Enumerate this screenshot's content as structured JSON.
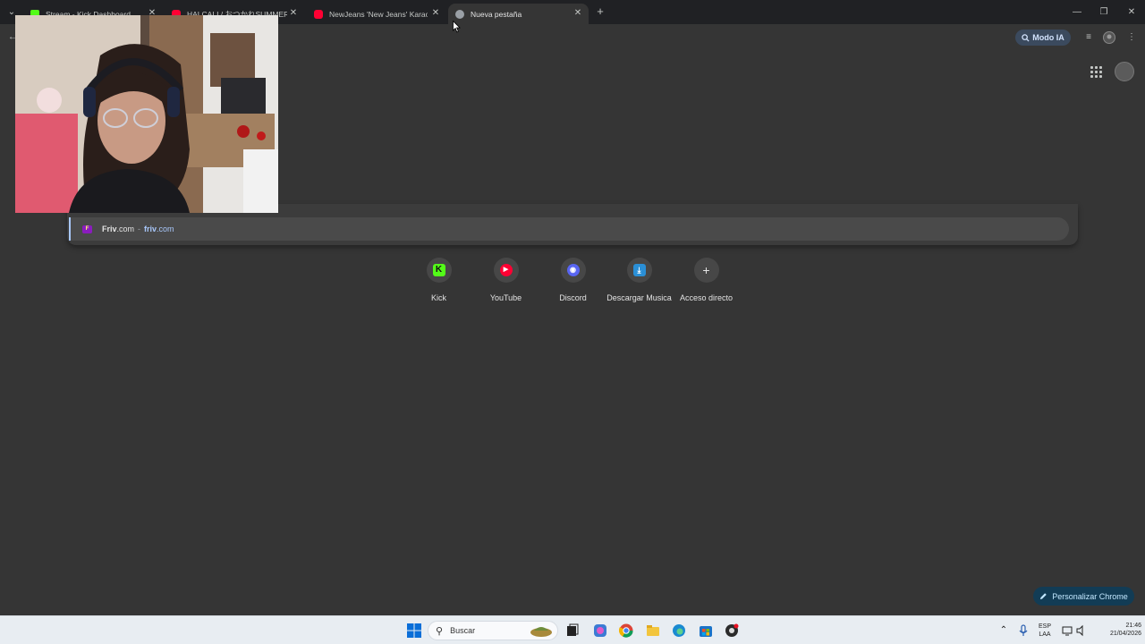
{
  "tabs": [
    {
      "title": "Stream - Kick Dashboard",
      "favicon": "kick-icon"
    },
    {
      "title": "HALCALI / おつかれSUMMER (O",
      "favicon": "youtube-icon"
    },
    {
      "title": "NewJeans 'New Jeans' Karaoke",
      "favicon": "youtube-icon"
    },
    {
      "title": "Nueva pestaña",
      "favicon": "chrome-icon",
      "active": true
    }
  ],
  "toolbar": {
    "ai_mode_label": "Modo IA"
  },
  "suggestion": {
    "name_bold": "Friv",
    "name_rest": ".com",
    "separator": "-",
    "url_bold": "friv",
    "url_rest": ".com"
  },
  "shortcuts": [
    {
      "label": "Kick",
      "icon": "kick-icon"
    },
    {
      "label": "YouTube",
      "icon": "youtube-icon"
    },
    {
      "label": "Discord",
      "icon": "discord-icon"
    },
    {
      "label": "Descargar Musica",
      "icon": "download-icon"
    },
    {
      "label": "Acceso directo",
      "icon": "plus-icon"
    }
  ],
  "customize_label": "Personalizar Chrome",
  "taskbar": {
    "search_placeholder": "Buscar",
    "lang_top": "ESP",
    "lang_bottom": "LAA",
    "time": "21:46",
    "date": "21/04/2026"
  },
  "colors": {
    "accent": "#a8c7fa",
    "kick_green": "#53fc18",
    "youtube_red": "#ff0033",
    "ntp_bg": "#353535"
  }
}
